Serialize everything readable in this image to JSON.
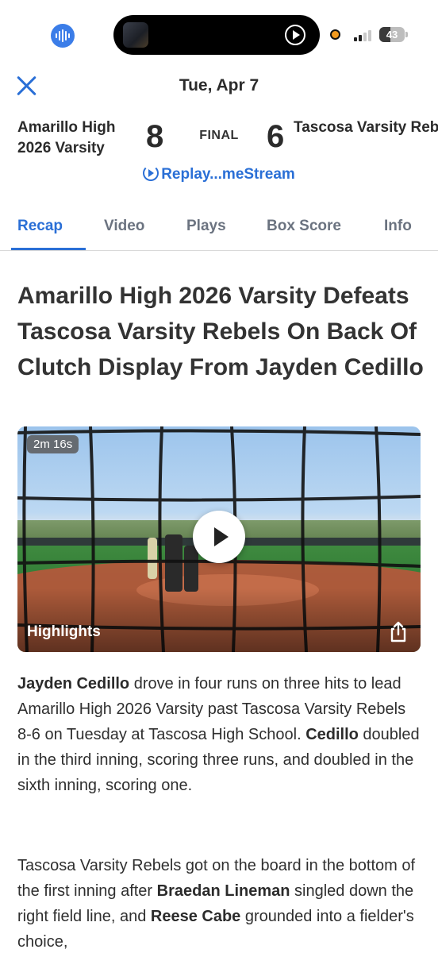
{
  "status_bar": {
    "battery": "43",
    "battery_level": 0.43,
    "signal_bars_active": 2
  },
  "header": {
    "date": "Tue, Apr 7",
    "home_team": "Amarillo High 2026 Varsity",
    "home_score": "8",
    "status": "FINAL",
    "away_score": "6",
    "away_team": "Tascosa Varsity Reb...",
    "replay_link": "Replay...meStream"
  },
  "tabs": [
    {
      "label": "Recap",
      "active": true
    },
    {
      "label": "Video",
      "active": false
    },
    {
      "label": "Plays",
      "active": false
    },
    {
      "label": "Box Score",
      "active": false
    },
    {
      "label": "Info",
      "active": false
    }
  ],
  "article": {
    "headline": "Amarillo High 2026 Varsity Defeats Tascosa Varsity Rebels On Back Of Clutch Display From Jayden Cedillo",
    "video": {
      "duration": "2m 16s",
      "label": "Highlights"
    },
    "p1": {
      "name1": "Jayden Cedillo",
      "text1": " drove in four runs on three hits to lead Amarillo High 2026 Varsity past Tascosa Varsity Rebels 8-6 on Tuesday at Tascosa High School. ",
      "name2": "Cedillo",
      "text2": " doubled in the third inning, scoring three runs, and doubled in the sixth inning, scoring one."
    },
    "p2": {
      "text1": "Tascosa Varsity Rebels got on the board in the bottom of the first inning after ",
      "name1": "Braedan Lineman",
      "text2": " singled down the right field line, and ",
      "name2": "Reese  Cabe",
      "text3": " grounded into a fielder's choice,"
    }
  },
  "colors": {
    "accent": "#2a6fd6",
    "text": "#2b2b2b",
    "tab_inactive": "#6b7380"
  }
}
